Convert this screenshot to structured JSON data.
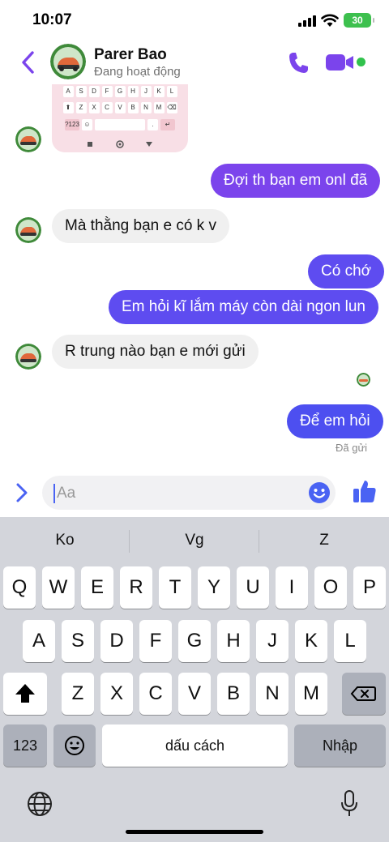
{
  "status_bar": {
    "time": "10:07",
    "battery": "30"
  },
  "header": {
    "name": "Parer Bao",
    "status": "Đang hoạt động"
  },
  "mini_keyboard": {
    "row1": [
      "A",
      "S",
      "D",
      "F",
      "G",
      "H",
      "J",
      "K",
      "L"
    ],
    "row2": [
      "⬆",
      "Z",
      "X",
      "C",
      "V",
      "B",
      "N",
      "M",
      "⌫"
    ],
    "row3_left": "?123",
    "row3_right": "↵"
  },
  "messages": [
    {
      "dir": "out",
      "text": "Đợi th bạn em onl đã"
    },
    {
      "dir": "in",
      "text": "Mà thằng bạn e có k v"
    },
    {
      "dir": "out",
      "text": "Có chớ"
    },
    {
      "dir": "out",
      "text": "Em hỏi kĩ lắm máy còn dài ngon lun"
    },
    {
      "dir": "in",
      "text": "R trung nào bạn e mới gửi"
    },
    {
      "dir": "out",
      "text": "Để em hỏi"
    }
  ],
  "sent_status": "Đã gửi",
  "composer": {
    "placeholder": "Aa"
  },
  "keyboard": {
    "suggestions": [
      "Ko",
      "Vg",
      "Z"
    ],
    "row1": [
      "Q",
      "W",
      "E",
      "R",
      "T",
      "Y",
      "U",
      "I",
      "O",
      "P"
    ],
    "row2": [
      "A",
      "S",
      "D",
      "F",
      "G",
      "H",
      "J",
      "K",
      "L"
    ],
    "row3": [
      "Z",
      "X",
      "C",
      "V",
      "B",
      "N",
      "M"
    ],
    "numbers_label": "123",
    "space_label": "dấu cách",
    "return_label": "Nhập"
  },
  "colors": {
    "accent": "#7b44ec",
    "online": "#31c24d",
    "battery": "#3dc04e"
  }
}
